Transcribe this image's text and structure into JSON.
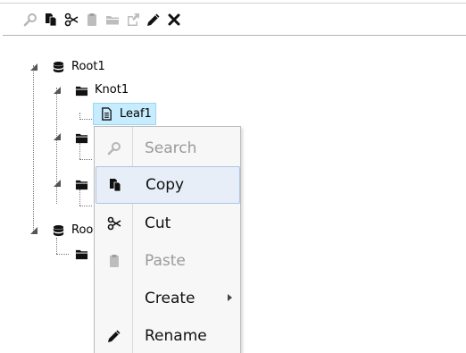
{
  "toolbar": {
    "buttons": [
      {
        "icon": "search-icon",
        "label": "Search",
        "enabled": false
      },
      {
        "icon": "copy-icon",
        "label": "Copy",
        "enabled": true
      },
      {
        "icon": "cut-icon",
        "label": "Cut",
        "enabled": true
      },
      {
        "icon": "paste-icon",
        "label": "Paste",
        "enabled": false
      },
      {
        "icon": "folder-icon",
        "label": "Create",
        "enabled": false
      },
      {
        "icon": "export-icon",
        "label": "Export",
        "enabled": false
      },
      {
        "icon": "pencil-icon",
        "label": "Rename",
        "enabled": true
      },
      {
        "icon": "delete-icon",
        "label": "Delete",
        "enabled": true
      }
    ]
  },
  "tree": {
    "root1": {
      "label": "Root1",
      "icon": "database-icon"
    },
    "knot1": {
      "label": "Knot1",
      "icon": "folder-icon"
    },
    "leaf1": {
      "label": "Leaf1",
      "icon": "document-icon",
      "selected": true
    },
    "root2": {
      "label": "Roo",
      "icon": "database-icon"
    }
  },
  "context_menu": {
    "items": [
      {
        "label": "Search",
        "icon": "search-icon",
        "enabled": false
      },
      {
        "label": "Copy",
        "icon": "copy-icon",
        "enabled": true,
        "hovered": true
      },
      {
        "label": "Cut",
        "icon": "cut-icon",
        "enabled": true
      },
      {
        "label": "Paste",
        "icon": "paste-icon",
        "enabled": false
      },
      {
        "label": "Create",
        "icon": "",
        "enabled": true,
        "submenu": true
      },
      {
        "label": "Rename",
        "icon": "pencil-icon",
        "enabled": true
      }
    ]
  },
  "colors": {
    "selection_bg": "#c6ecfd",
    "menu_bg": "#f7f7f7",
    "menu_hover_bg": "#e7eef8",
    "disabled_text": "#9a9a9a"
  }
}
